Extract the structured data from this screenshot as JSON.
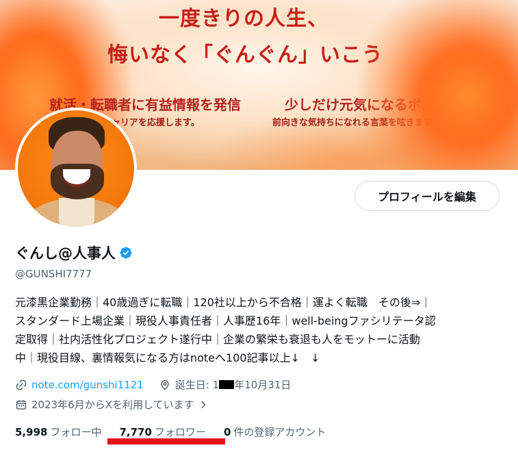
{
  "banner": {
    "headline_line1": "一度きりの人生、",
    "headline_line2": "悔いなく「ぐんぐん」いこう",
    "left_title": "就活・転職者に有益情報を発信",
    "left_desc": "キャリアを応援します。",
    "right_title": "少しだけ元気になるポスト",
    "right_desc": "前向きな気持ちになれる言葉を呟きます。"
  },
  "profile": {
    "edit_button": "プロフィールを編集",
    "display_name": "ぐんし@人事人",
    "handle": "@GUNSHI7777",
    "bio_lines": [
      "元漆黒企業勤務｜40歳過ぎに転職｜120社以上から不合格｜運よく転職　その後⇒｜",
      "スタンダード上場企業｜現役人事責任者｜人事歴16年｜well-beingファシリテータ認",
      "定取得｜社内活性化プロジェクト遂行中｜企業の繁栄も衰退も人をモットーに活動",
      "中｜現役目線、裏情報気になる方はnoteへ100記事以上↓　↓"
    ],
    "link_text": "note.com/gunshi1121",
    "birthday_prefix": "誕生日: 1",
    "birthday_suffix": "年10月31日",
    "joined": "2023年6月からXを利用しています"
  },
  "stats": {
    "following_count": "5,998",
    "following_label": "フォロー中",
    "followers_count": "7,770",
    "followers_label": "フォロワー",
    "subscribed_count": "0",
    "subscribed_label": "件の登録アカウント"
  },
  "colors": {
    "accent": "#1d9bf0",
    "banner_title": "#c8201a",
    "highlight": "#e3161a",
    "secondary_text": "#536471"
  },
  "icons": [
    "verified-badge-icon",
    "link-icon",
    "location-pin-icon",
    "calendar-icon",
    "chevron-right-icon"
  ]
}
